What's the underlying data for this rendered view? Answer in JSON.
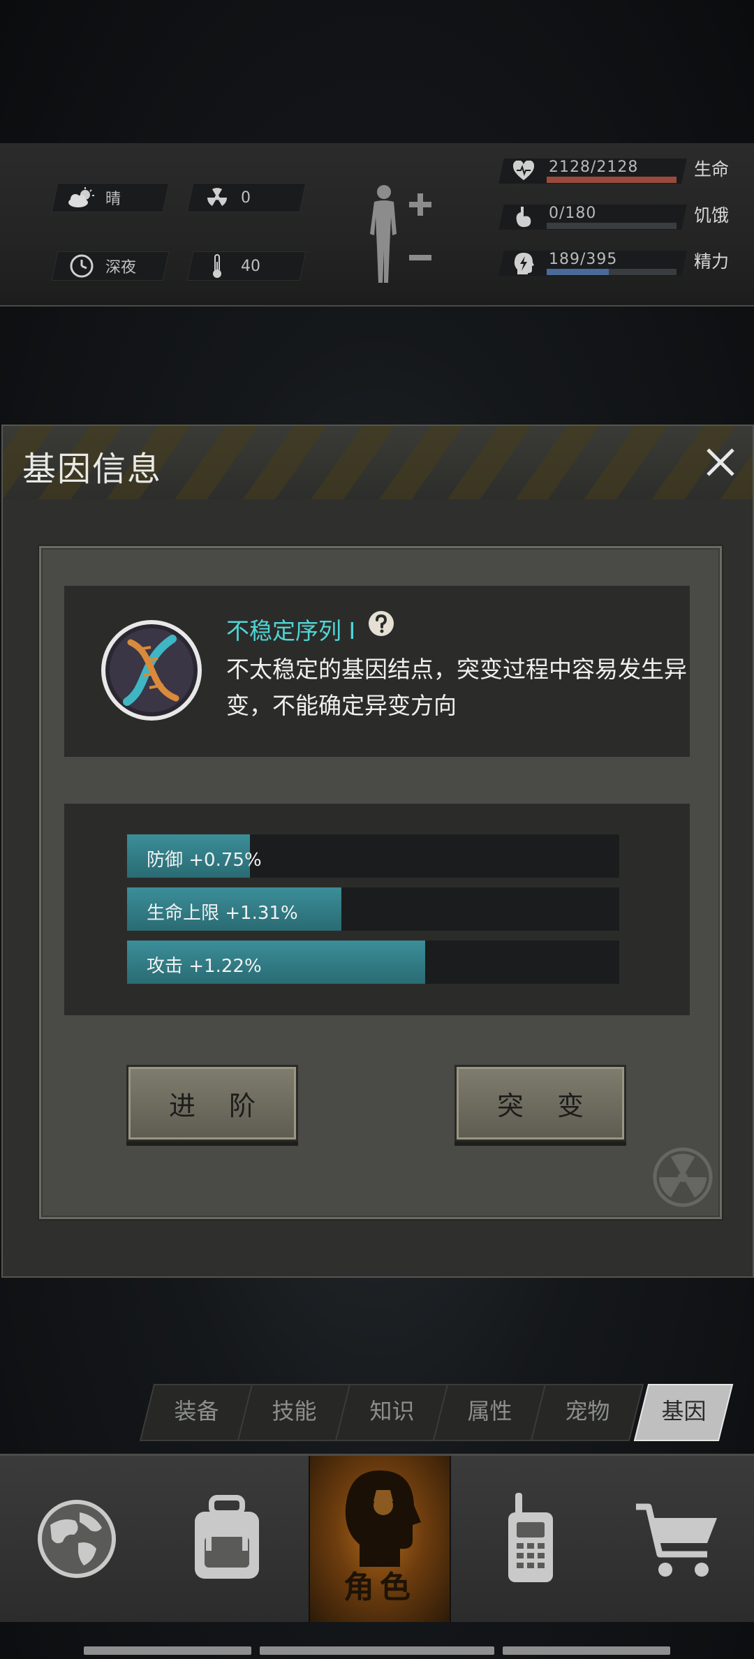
{
  "status": {
    "weather": {
      "icon": "cloudy-sun-icon",
      "label": "晴"
    },
    "radiation": {
      "icon": "radiation-icon",
      "value": "0"
    },
    "time": {
      "icon": "clock-icon",
      "label": "深夜"
    },
    "temperature": {
      "icon": "thermometer-icon",
      "value": "40"
    },
    "stats": [
      {
        "icon": "heart-icon",
        "value": "2128/2128",
        "name": "生命",
        "ratio": 1.0,
        "color": "#9a4a3c"
      },
      {
        "icon": "stomach-icon",
        "value": "0/180",
        "name": "饥饿",
        "ratio": 0.0,
        "color": "#8a8a8a"
      },
      {
        "icon": "energy-head-icon",
        "value": "189/395",
        "name": "精力",
        "ratio": 0.478,
        "color": "#4a6b9a"
      }
    ]
  },
  "modal": {
    "title": "基因信息",
    "gene": {
      "name": "不稳定序列 I",
      "description": "不太稳定的基因结点，突变过程中容易发生异变，不能确定异变方向"
    },
    "attributes": [
      {
        "label": "防御 +0.75%",
        "fill_ratio": 0.25
      },
      {
        "label": "生命上限 +1.31%",
        "fill_ratio": 0.435
      },
      {
        "label": "攻击 +1.22%",
        "fill_ratio": 0.605
      }
    ],
    "buttons": {
      "advance": "进 阶",
      "mutate": "突 变"
    }
  },
  "sub_tabs": [
    {
      "label": "装备",
      "active": false
    },
    {
      "label": "技能",
      "active": false
    },
    {
      "label": "知识",
      "active": false
    },
    {
      "label": "属性",
      "active": false
    },
    {
      "label": "宠物",
      "active": false
    },
    {
      "label": "基因",
      "active": true
    }
  ],
  "bottom_nav": {
    "items": [
      {
        "icon": "globe-icon"
      },
      {
        "icon": "backpack-icon"
      },
      {
        "icon": "character-head-icon",
        "label": "角色",
        "active": true
      },
      {
        "icon": "walkie-talkie-icon"
      },
      {
        "icon": "shopping-cart-icon"
      }
    ]
  }
}
